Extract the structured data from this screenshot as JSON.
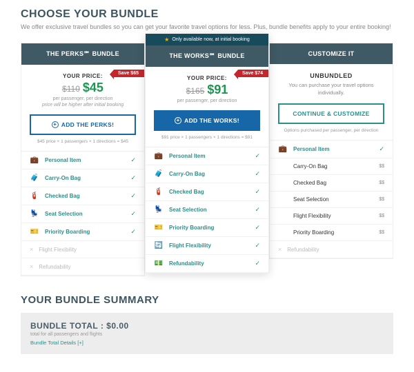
{
  "header": {
    "title": "CHOOSE YOUR BUNDLE",
    "subtitle": "We offer exclusive travel bundles so you can get your favorite travel options for less. Plus, bundle benefits apply to your entire booking!"
  },
  "featured_bar": "Only available now, at initial booking",
  "columns": [
    {
      "title": "THE PERKS℠ BUNDLE",
      "ribbon": "Save $65",
      "price_label": "YOUR PRICE:",
      "old_price": "$110",
      "new_price": "$45",
      "per": "per passenger, per direction",
      "note": "price will be higher after initial booking",
      "button": "ADD THE PERKS!",
      "math": "$45 price × 1 passengers × 1 directions = $45"
    },
    {
      "title": "THE WORKS℠ BUNDLE",
      "ribbon": "Save $74",
      "price_label": "YOUR PRICE:",
      "old_price": "$165",
      "new_price": "$91",
      "per": "per passenger, per direction",
      "button": "ADD THE WORKS!",
      "math": "$91 price × 1 passengers × 1 directions = $91"
    },
    {
      "title": "CUSTOMIZE IT",
      "unbundled_title": "UNBUNDLED",
      "unbundled_text": "You can purchase your travel options individually.",
      "button": "CONTINUE & CUSTOMIZE",
      "math": "Options purchased per passenger, per direction"
    }
  ],
  "features": {
    "perks": [
      {
        "icon": "💼",
        "label": "Personal Item",
        "status": "included"
      },
      {
        "icon": "🧳",
        "label": "Carry-On Bag",
        "status": "included"
      },
      {
        "icon": "🧯",
        "label": "Checked Bag",
        "status": "included"
      },
      {
        "icon": "💺",
        "label": "Seat Selection",
        "status": "included"
      },
      {
        "icon": "🎫",
        "label": "Priority Boarding",
        "status": "included"
      },
      {
        "icon": "",
        "label": "Flight Flexibility",
        "status": "excluded"
      },
      {
        "icon": "",
        "label": "Refundability",
        "status": "excluded"
      }
    ],
    "works": [
      {
        "icon": "💼",
        "label": "Personal Item",
        "status": "included"
      },
      {
        "icon": "🧳",
        "label": "Carry-On Bag",
        "status": "included"
      },
      {
        "icon": "🧯",
        "label": "Checked Bag",
        "status": "included"
      },
      {
        "icon": "💺",
        "label": "Seat Selection",
        "status": "included"
      },
      {
        "icon": "🎫",
        "label": "Priority Boarding",
        "status": "included"
      },
      {
        "icon": "🔄",
        "label": "Flight Flexibility",
        "status": "included"
      },
      {
        "icon": "💵",
        "label": "Refundability",
        "status": "included"
      }
    ],
    "customize": [
      {
        "icon": "💼",
        "label": "Personal Item",
        "status": "included"
      },
      {
        "label": "Carry-On Bag",
        "status": "priced",
        "price": "$$"
      },
      {
        "label": "Checked Bag",
        "status": "priced",
        "price": "$$"
      },
      {
        "label": "Seat Selection",
        "status": "priced",
        "price": "$$"
      },
      {
        "label": "Flight Flexibility",
        "status": "priced",
        "price": "$$"
      },
      {
        "label": "Priority Boarding",
        "status": "priced",
        "price": "$$"
      },
      {
        "label": "Refundability",
        "status": "excluded"
      }
    ]
  },
  "summary": {
    "title": "YOUR BUNDLE SUMMARY",
    "total_label": "BUNDLE TOTAL : ",
    "total_value": "$0.00",
    "sub": "total for all passengers and flights",
    "details": "Bundle Total Details [+]"
  }
}
